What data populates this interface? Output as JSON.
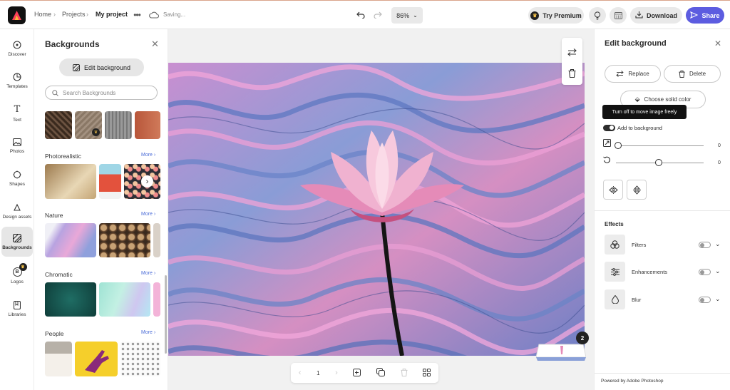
{
  "header": {
    "breadcrumb": [
      "Home",
      "Projects",
      "My project"
    ],
    "status": "Saving...",
    "zoom": "86%",
    "premium_label": "Try Premium",
    "download_label": "Download",
    "share_label": "Share"
  },
  "rail": {
    "items": [
      {
        "label": "Discover",
        "icon": "discover-icon"
      },
      {
        "label": "Templates",
        "icon": "templates-icon"
      },
      {
        "label": "Text",
        "icon": "text-icon"
      },
      {
        "label": "Photos",
        "icon": "photos-icon"
      },
      {
        "label": "Shapes",
        "icon": "shapes-icon"
      },
      {
        "label": "Design assets",
        "icon": "design-assets-icon"
      },
      {
        "label": "Backgrounds",
        "icon": "backgrounds-icon"
      },
      {
        "label": "Logos",
        "icon": "logos-icon"
      },
      {
        "label": "Libraries",
        "icon": "libraries-icon"
      }
    ]
  },
  "panel": {
    "title": "Backgrounds",
    "edit_button": "Edit background",
    "search_placeholder": "Search Backgrounds",
    "sections": [
      {
        "title": "Photorealistic",
        "more": "More"
      },
      {
        "title": "Nature",
        "more": "More"
      },
      {
        "title": "Chromatic",
        "more": "More"
      },
      {
        "title": "People",
        "more": "More"
      }
    ]
  },
  "canvas": {
    "page_number": "1",
    "page_count_badge": "2"
  },
  "edit_panel": {
    "title": "Edit background",
    "replace_label": "Replace",
    "delete_label": "Delete",
    "solid_color_label": "Choose solid color",
    "tooltip": "Turn off to move image freely",
    "add_to_background_label": "Add to background",
    "add_to_background_on": true,
    "scale_value": "0",
    "rotate_value": "0",
    "effects_title": "Effects",
    "effects": [
      {
        "label": "Filters",
        "on": false
      },
      {
        "label": "Enhancements",
        "on": false
      },
      {
        "label": "Blur",
        "on": false
      }
    ],
    "footer": "Powered by Adobe Photoshop"
  },
  "colors": {
    "accent": "#5c5ce0",
    "link": "#4b6cd8",
    "marble_pink": "#d98fc4",
    "marble_blue": "#6f86c9"
  }
}
